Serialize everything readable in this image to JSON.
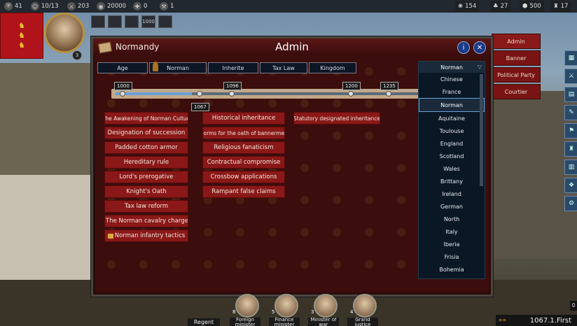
{
  "top_resources": [
    {
      "icon": "shield-icon",
      "value": "41"
    },
    {
      "icon": "population-icon",
      "value": "10/13"
    },
    {
      "icon": "troops-icon",
      "value": "203"
    },
    {
      "icon": "gold-icon",
      "value": "20000"
    },
    {
      "icon": "faith-icon",
      "value": "0"
    },
    {
      "icon": "tools-icon",
      "value": "1"
    }
  ],
  "right_resources": [
    {
      "icon": "food-icon",
      "value": "154"
    },
    {
      "icon": "wood-icon",
      "value": "27"
    },
    {
      "icon": "iron-icon",
      "value": "500"
    },
    {
      "icon": "tower-icon",
      "value": "17"
    }
  ],
  "player": {
    "level": "3"
  },
  "mini_icons": [
    "",
    "",
    "",
    "1000",
    ""
  ],
  "panel": {
    "region": "Normandy",
    "title": "Admin",
    "info_btn": "i",
    "close_btn": "✕"
  },
  "tabs": [
    "Age",
    "Norman",
    "Inherite",
    "Tax Law",
    "Kingdom"
  ],
  "timeline": {
    "marks_above": [
      "1000",
      "1096",
      "1200",
      "1235"
    ],
    "mark_below": "1067",
    "progress": 0.25
  },
  "col1": [
    "The Awakening of Norman Culture",
    "Designation of succession",
    "Padded cotton armor",
    "Hereditary rule",
    "Lord's prerogative",
    "Knight's Oath",
    "Tax law reform",
    "The Norman cavalry charge",
    "Norman infantry tactics"
  ],
  "col2": [
    "Historical inheritance",
    "Norms for the oath of bannermen",
    "Religious fanaticism",
    "Contractual compromise",
    "Crossbow applications",
    "Rampant false claims"
  ],
  "col3": [
    "Statutory designated inheritance"
  ],
  "dropdown": {
    "selected": "Norman",
    "options": [
      "Chinese",
      "France",
      "Norman",
      "Aquitaine",
      "Toulouse",
      "England",
      "Scotland",
      "Wales",
      "Brittany",
      "Ireland",
      "German",
      "North",
      "Italy",
      "Iberia",
      "Frisia",
      "Bohemia"
    ]
  },
  "side_tabs": [
    "Admin",
    "Banner",
    "Political Party",
    "Courtier"
  ],
  "ministers": [
    {
      "num": "",
      "name": "Regent"
    },
    {
      "num": "8",
      "name": "Foreign minister"
    },
    {
      "num": "5",
      "name": "Finance minister"
    },
    {
      "num": "3",
      "name": "Minister of war"
    },
    {
      "num": "4",
      "name": "Grand justice"
    }
  ],
  "date": "1067.1.First",
  "right_edge_value": "0"
}
